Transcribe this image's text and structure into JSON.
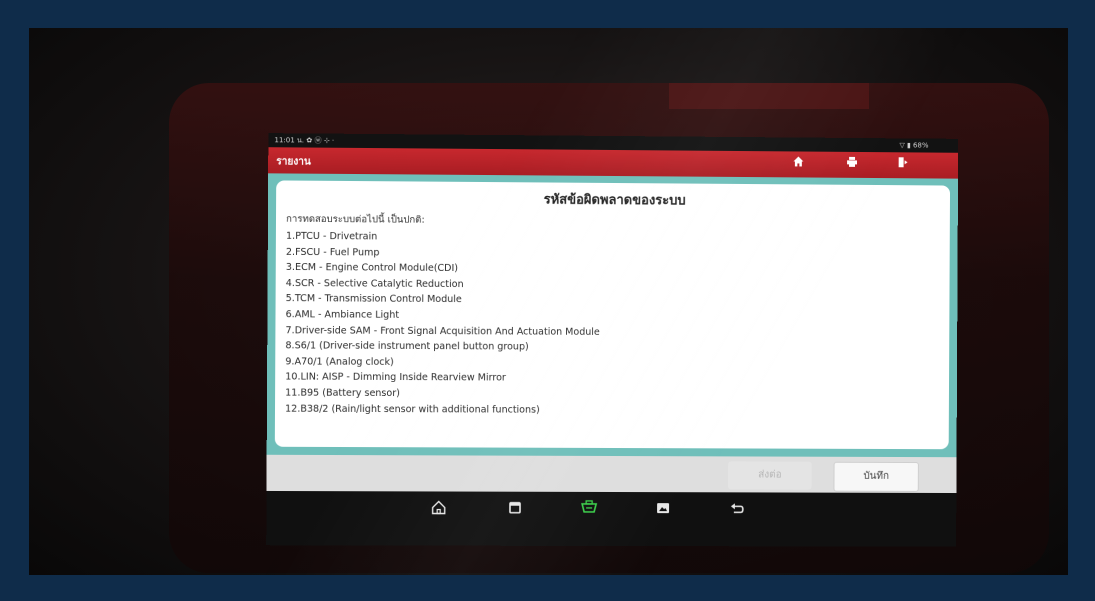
{
  "status_bar": {
    "left": "11:01 น. ✿ ⓦ ⊹ ·",
    "right": "▽ ▮ 68%"
  },
  "title_bar": {
    "title": "รายงาน"
  },
  "header_icons": [
    "home-icon",
    "print-icon",
    "exit-icon"
  ],
  "report": {
    "heading": "รหัสข้อผิดพลาดของระบบ",
    "intro": "การทดสอบระบบต่อไปนี้ เป็นปกติ:",
    "items": [
      "1.PTCU - Drivetrain",
      "2.FSCU - Fuel Pump",
      "3.ECM - Engine Control Module(CDI)",
      "4.SCR - Selective Catalytic Reduction",
      "5.TCM - Transmission Control Module",
      "6.AML - Ambiance Light",
      "7.Driver-side SAM - Front Signal Acquisition And Actuation Module",
      "8.S6/1 (Driver-side instrument panel button group)",
      "9.A70/1 (Analog clock)",
      "10.LIN: AISP - Dimming Inside Rearview Mirror",
      "11.B95 (Battery sensor)",
      "12.B38/2 (Rain/light sensor with additional functions)"
    ]
  },
  "footer": {
    "send_label": "ส่งต่อ",
    "save_label": "บันทึก"
  },
  "nav_bar": {
    "icons": [
      "home-outline-icon",
      "recent-apps-icon",
      "diagnostic-connector-icon",
      "screenshot-icon",
      "back-icon"
    ]
  },
  "colors": {
    "title_bar": "#b82228",
    "content_border": "#6fbfba",
    "page_frame": "#0f2c4a",
    "diag_green": "#3bd14a"
  }
}
